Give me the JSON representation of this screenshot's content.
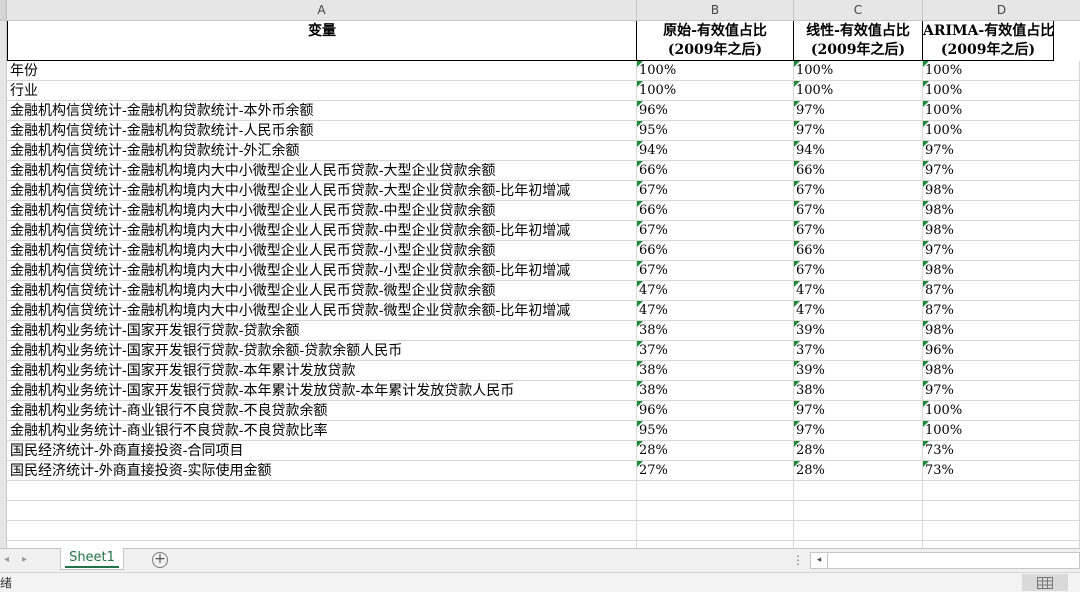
{
  "sheet": {
    "columns": [
      "A",
      "B",
      "C",
      "D"
    ],
    "header": [
      [
        "变量",
        ""
      ],
      [
        "原始-有效值占比",
        "(2009年之后)"
      ],
      [
        "线性-有效值占比",
        "(2009年之后)"
      ],
      [
        "ARIMA-有效值占比",
        "(2009年之后)"
      ]
    ],
    "rows": [
      [
        "年份",
        "100%",
        "100%",
        "100%"
      ],
      [
        "行业",
        "100%",
        "100%",
        "100%"
      ],
      [
        "金融机构信贷统计-金融机构贷款统计-本外币余额",
        "96%",
        "97%",
        "100%"
      ],
      [
        "金融机构信贷统计-金融机构贷款统计-人民币余额",
        "95%",
        "97%",
        "100%"
      ],
      [
        "金融机构信贷统计-金融机构贷款统计-外汇余额",
        "94%",
        "94%",
        "97%"
      ],
      [
        "金融机构信贷统计-金融机构境内大中小微型企业人民币贷款-大型企业贷款余额",
        "66%",
        "66%",
        "97%"
      ],
      [
        "金融机构信贷统计-金融机构境内大中小微型企业人民币贷款-大型企业贷款余额-比年初增减",
        "67%",
        "67%",
        "98%"
      ],
      [
        "金融机构信贷统计-金融机构境内大中小微型企业人民币贷款-中型企业贷款余额",
        "66%",
        "67%",
        "98%"
      ],
      [
        "金融机构信贷统计-金融机构境内大中小微型企业人民币贷款-中型企业贷款余额-比年初增减",
        "67%",
        "67%",
        "98%"
      ],
      [
        "金融机构信贷统计-金融机构境内大中小微型企业人民币贷款-小型企业贷款余额",
        "66%",
        "66%",
        "97%"
      ],
      [
        "金融机构信贷统计-金融机构境内大中小微型企业人民币贷款-小型企业贷款余额-比年初增减",
        "67%",
        "67%",
        "98%"
      ],
      [
        "金融机构信贷统计-金融机构境内大中小微型企业人民币贷款-微型企业贷款余额",
        "47%",
        "47%",
        "87%"
      ],
      [
        "金融机构信贷统计-金融机构境内大中小微型企业人民币贷款-微型企业贷款余额-比年初增减",
        "47%",
        "47%",
        "87%"
      ],
      [
        "金融机构业务统计-国家开发银行贷款-贷款余额",
        "38%",
        "39%",
        "98%"
      ],
      [
        "金融机构业务统计-国家开发银行贷款-贷款余额-贷款余额人民币",
        "37%",
        "37%",
        "96%"
      ],
      [
        "金融机构业务统计-国家开发银行贷款-本年累计发放贷款",
        "38%",
        "39%",
        "98%"
      ],
      [
        "金融机构业务统计-国家开发银行贷款-本年累计发放贷款-本年累计发放贷款人民币",
        "38%",
        "38%",
        "97%"
      ],
      [
        "金融机构业务统计-商业银行不良贷款-不良贷款余额",
        "96%",
        "97%",
        "100%"
      ],
      [
        "金融机构业务统计-商业银行不良贷款-不良贷款比率",
        "95%",
        "97%",
        "100%"
      ],
      [
        "国民经济统计-外商直接投资-合同项目",
        "28%",
        "28%",
        "73%"
      ],
      [
        "国民经济统计-外商直接投资-实际使用金额",
        "27%",
        "28%",
        "73%"
      ]
    ]
  },
  "tabs": {
    "active": "Sheet1",
    "add_label": "+"
  },
  "status": {
    "text": "绪"
  },
  "icons": {
    "tri_color": "#1f8a3c",
    "accent": "#217346",
    "nav_left": "◂",
    "nav_right": "▸",
    "scroll_left": "◂",
    "dots": "⋮"
  }
}
